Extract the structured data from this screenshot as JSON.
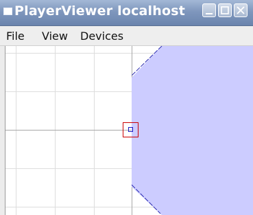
{
  "window": {
    "title": "PlayerViewer localhost"
  },
  "menubar": {
    "items": [
      "File",
      "View",
      "Devices"
    ]
  },
  "colors": {
    "titlebar": "#7f97bd",
    "obstacle_fill": "#ccccff",
    "obstacle_edge": "#2a2ab0",
    "robot_box": "#cc0000",
    "robot_marker": "#1a1ac0",
    "grid": "#dddddd",
    "axis": "#999999"
  },
  "icons": {
    "window_menu": "window-icon",
    "minimize": "minimize-icon",
    "maximize": "maximize-icon",
    "close": "close-icon"
  }
}
